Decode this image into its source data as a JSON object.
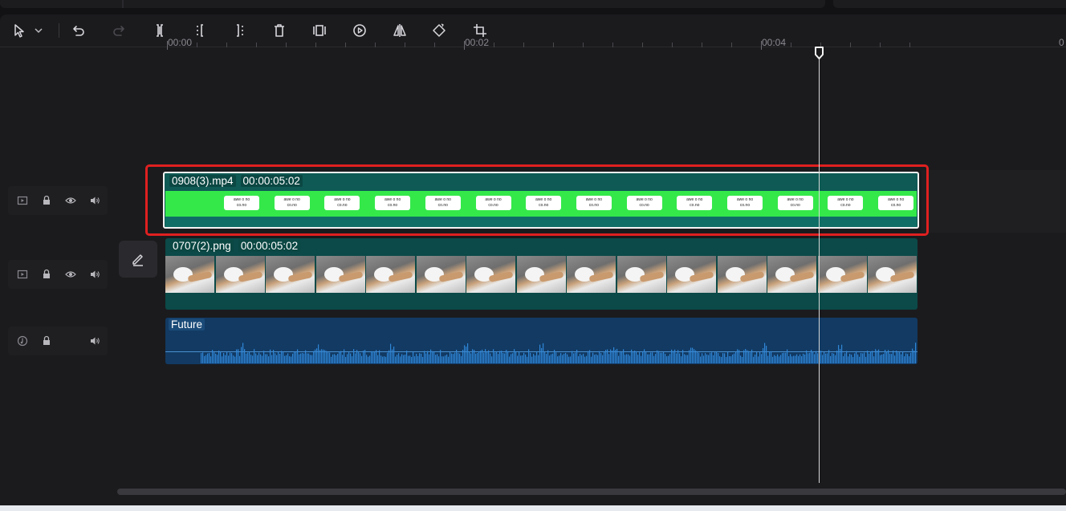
{
  "toolbar": {
    "items": [
      {
        "name": "select-tool-icon"
      },
      {
        "name": "select-dropdown-icon"
      },
      {
        "name": "undo-icon"
      },
      {
        "name": "redo-icon"
      },
      {
        "name": "split-icon"
      },
      {
        "name": "split-left-icon"
      },
      {
        "name": "split-right-icon"
      },
      {
        "name": "delete-icon"
      },
      {
        "name": "freeze-frame-icon"
      },
      {
        "name": "speed-icon"
      },
      {
        "name": "mirror-icon"
      },
      {
        "name": "rotate-icon"
      },
      {
        "name": "crop-icon"
      }
    ]
  },
  "ruler": {
    "labels": [
      "00:00",
      "00:02",
      "00:04",
      "0"
    ]
  },
  "tracks": {
    "video": {
      "clip_name": "0908(3).mp4",
      "duration": "00:00:05:02",
      "thumb_text": "awe o no\nco.no"
    },
    "image": {
      "clip_name": "0707(2).png",
      "duration": "00:00:05:02"
    },
    "audio": {
      "clip_name": "Future"
    }
  },
  "colors": {
    "selection": "#e02020",
    "video_clip_band": "#34e84a",
    "image_clip": "#0b4a48",
    "audio_clip": "#123a63",
    "playhead": "#d8d8d8"
  }
}
